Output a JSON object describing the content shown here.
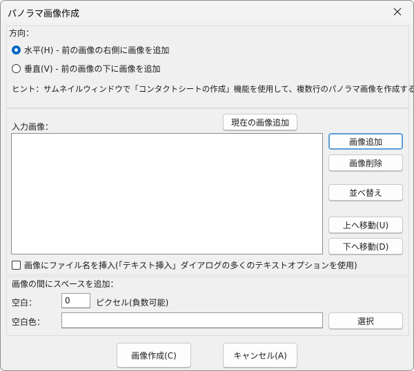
{
  "window": {
    "title": "パノラマ画像作成"
  },
  "direction": {
    "label": "方向：",
    "horizontal": {
      "label": "水平(H) - 前の画像の右側に画像を追加",
      "checked": true
    },
    "vertical": {
      "label": "垂直(V) - 前の画像の下に画像を追加",
      "checked": false
    },
    "hint": "ヒント：サムネイルウィンドウで「コンタクトシートの作成」機能を使用して、複数行のパノラマ画像を作成することができます"
  },
  "input_images": {
    "label": "入力画像：",
    "add_current_button": "現在の画像追加",
    "add_button": "画像追加",
    "remove_button": "画像削除",
    "sort_button": "並べ替え",
    "move_up_button": "上へ移動(U)",
    "move_down_button": "下へ移動(D)",
    "insert_filename_checkbox": "画像にファイル名を挿入(「テキスト挿入」ダイアログの多くのテキストオプションを使用)"
  },
  "spacing": {
    "label": "画像の間にスペースを追加：",
    "blank_label": "空白：",
    "blank_value": "0",
    "blank_unit": "ピクセル(負数可能)",
    "color_label": "空白色：",
    "color_value": "",
    "select_button": "選択"
  },
  "footer": {
    "create_button": "画像作成(C)",
    "cancel_button": "キャンセル(A)"
  }
}
